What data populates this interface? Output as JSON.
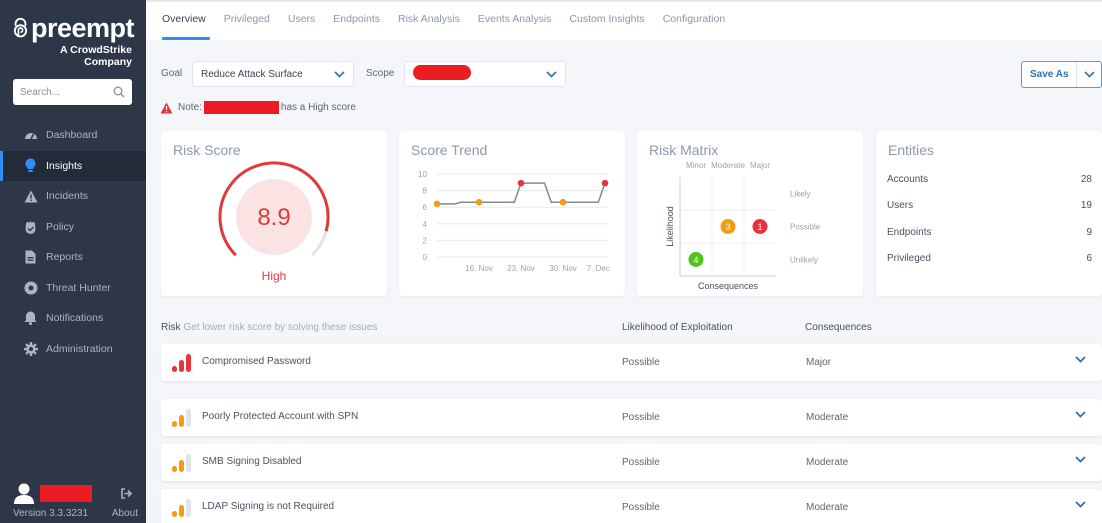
{
  "brand": {
    "name": "preempt",
    "tagline_line1": "A CrowdStrike",
    "tagline_line2": "Company"
  },
  "sidebar": {
    "search_placeholder": "Search...",
    "items": [
      {
        "label": "Dashboard",
        "icon": "dashboard-gauge-icon",
        "active": false
      },
      {
        "label": "Insights",
        "icon": "lightbulb-icon",
        "active": true
      },
      {
        "label": "Incidents",
        "icon": "warning-icon",
        "active": false
      },
      {
        "label": "Policy",
        "icon": "policy-icon",
        "active": false
      },
      {
        "label": "Reports",
        "icon": "document-icon",
        "active": false
      },
      {
        "label": "Threat Hunter",
        "icon": "target-icon",
        "active": false
      },
      {
        "label": "Notifications",
        "icon": "bell-icon",
        "active": false
      },
      {
        "label": "Administration",
        "icon": "gear-icon",
        "active": false
      }
    ],
    "version": "Version 3.3.3231",
    "about": "About"
  },
  "tabs": [
    {
      "label": "Overview",
      "active": true
    },
    {
      "label": "Privileged",
      "active": false
    },
    {
      "label": "Users",
      "active": false
    },
    {
      "label": "Endpoints",
      "active": false
    },
    {
      "label": "Risk Analysis",
      "active": false
    },
    {
      "label": "Events Analysis",
      "active": false
    },
    {
      "label": "Custom Insights",
      "active": false
    },
    {
      "label": "Configuration",
      "active": false
    }
  ],
  "filters": {
    "goal_label": "Goal",
    "goal_value": "Reduce Attack Surface",
    "scope_label": "Scope",
    "save_as": "Save As"
  },
  "note": {
    "prefix": "Note:",
    "suffix": "has a High score"
  },
  "risk_score": {
    "title": "Risk Score",
    "value": "8.9",
    "max": 10,
    "level": "High",
    "color": "#e03a3a"
  },
  "score_trend": {
    "title": "Score Trend"
  },
  "chart_data": {
    "type": "line",
    "title": "Score Trend",
    "xlabel": "",
    "ylabel": "",
    "ylim": [
      0,
      10
    ],
    "yticks": [
      "0",
      "2",
      "4",
      "6",
      "8",
      "10"
    ],
    "xtick_labels": [
      "16. Nov",
      "23. Nov",
      "30. Nov",
      "7. Dec"
    ],
    "grid": true,
    "series": [
      {
        "name": "Risk Score",
        "x": [
          0,
          0.11,
          0.14,
          0.25,
          0.46,
          0.5,
          0.64,
          0.68,
          0.75,
          0.96,
          1.0
        ],
        "values": [
          6.4,
          6.4,
          6.6,
          6.6,
          6.6,
          8.9,
          8.9,
          6.6,
          6.6,
          6.6,
          8.9
        ]
      }
    ],
    "markers": [
      {
        "x": 0,
        "value": 6.4,
        "color": "#f39c12"
      },
      {
        "x": 0.25,
        "value": 6.6,
        "color": "#f39c12"
      },
      {
        "x": 0.5,
        "value": 8.9,
        "color": "#e8323c"
      },
      {
        "x": 0.75,
        "value": 6.6,
        "color": "#f39c12"
      },
      {
        "x": 1.0,
        "value": 8.9,
        "color": "#e8323c"
      }
    ]
  },
  "risk_matrix": {
    "title": "Risk Matrix",
    "columns": [
      "Minor",
      "Moderate",
      "Major"
    ],
    "rows": [
      "Likely",
      "Possible",
      "Unlikely"
    ],
    "y_axis": "Likelihood",
    "x_axis": "Consequences",
    "bubbles": [
      {
        "row": "Possible",
        "col": "Moderate",
        "count": "3",
        "color": "#f39c12"
      },
      {
        "row": "Possible",
        "col": "Major",
        "count": "1",
        "color": "#e8323c"
      },
      {
        "row": "Unlikely",
        "col": "Minor",
        "count": "4",
        "color": "#52c41a"
      }
    ]
  },
  "entities": {
    "title": "Entities",
    "rows": [
      {
        "label": "Accounts",
        "value": "28"
      },
      {
        "label": "Users",
        "value": "19"
      },
      {
        "label": "Endpoints",
        "value": "9"
      },
      {
        "label": "Privileged",
        "value": "6"
      }
    ]
  },
  "risks": {
    "header_label": "Risk",
    "header_sub": "Get lower risk score by solving these issues",
    "col_likelihood": "Likelihood of Exploitation",
    "col_consequences": "Consequences",
    "items": [
      {
        "name": "Compromised Password",
        "likelihood": "Possible",
        "consequences": "Major",
        "severity": "high"
      },
      {
        "name": "Poorly Protected Account with SPN",
        "likelihood": "Possible",
        "consequences": "Moderate",
        "severity": "medium"
      },
      {
        "name": "SMB Signing Disabled",
        "likelihood": "Possible",
        "consequences": "Moderate",
        "severity": "medium"
      },
      {
        "name": "LDAP Signing is not Required",
        "likelihood": "Possible",
        "consequences": "Moderate",
        "severity": "medium"
      }
    ]
  }
}
